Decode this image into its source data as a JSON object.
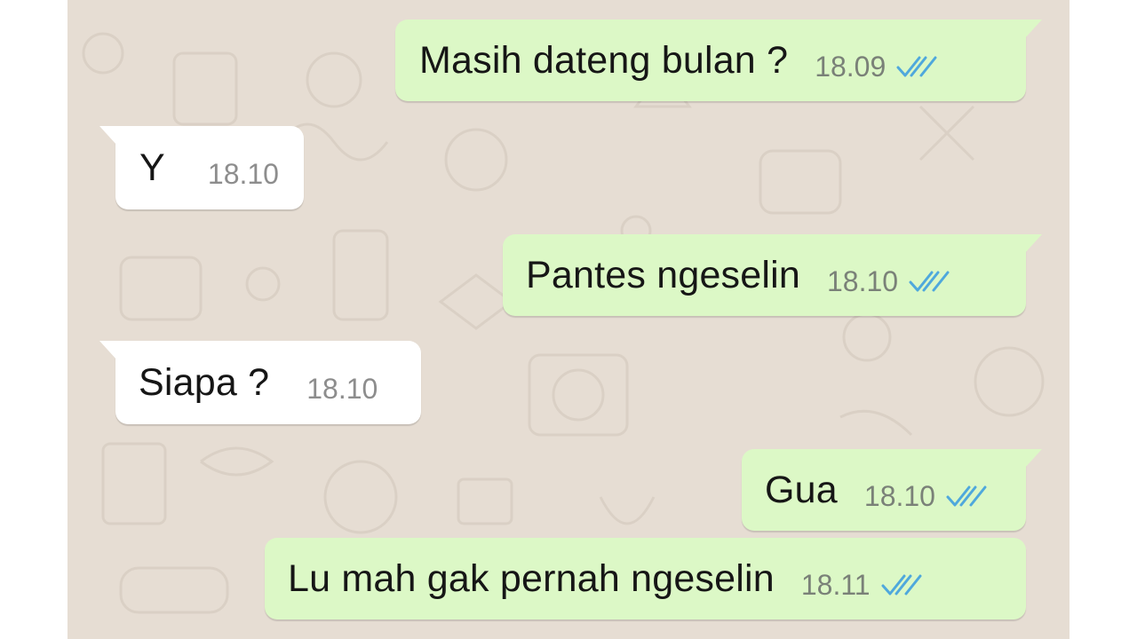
{
  "chat": {
    "messages": [
      {
        "direction": "outgoing",
        "text": "Masih dateng bulan ?",
        "time": "18.09",
        "status_icon": "double-check-read-icon"
      },
      {
        "direction": "incoming",
        "text": "Y",
        "time": "18.10"
      },
      {
        "direction": "outgoing",
        "text": "Pantes ngeselin",
        "time": "18.10",
        "status_icon": "double-check-read-icon"
      },
      {
        "direction": "incoming",
        "text": "Siapa ?",
        "time": "18.10"
      },
      {
        "direction": "outgoing",
        "text": "Gua",
        "time": "18.10",
        "status_icon": "double-check-read-icon"
      },
      {
        "direction": "outgoing",
        "text": "Lu mah gak pernah ngeselin",
        "time": "18.11",
        "status_icon": "double-check-read-icon"
      }
    ]
  },
  "colors": {
    "background": "#e6ddd3",
    "outgoing_bubble": "#dcf8c6",
    "incoming_bubble": "#ffffff",
    "read_ticks": "#4fa8dc"
  }
}
